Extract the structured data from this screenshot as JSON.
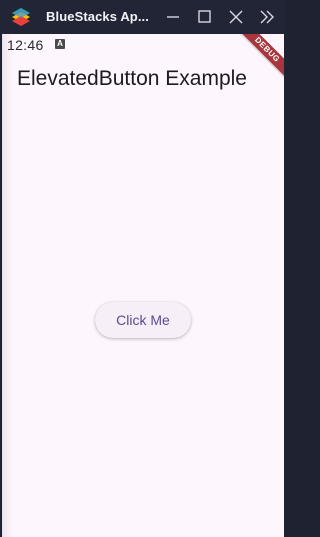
{
  "window": {
    "title": "BlueStacks Ap...",
    "logo_icon": "bluestacks-logo-icon",
    "controls": {
      "minimize_icon": "minimize-icon",
      "maximize_icon": "maximize-icon",
      "close_icon": "close-icon",
      "more_icon": "double-chevron-right-icon"
    }
  },
  "statusbar": {
    "time": "12:46",
    "notification_icon_letter": "A"
  },
  "debug_banner": {
    "text": "DEBUG",
    "color": "#a8373d"
  },
  "app": {
    "title": "ElevatedButton Example",
    "button_label": "Click Me",
    "colors": {
      "background": "#fdf6fc",
      "button_bg": "#f6eff8",
      "button_text": "#5b4a92"
    }
  }
}
